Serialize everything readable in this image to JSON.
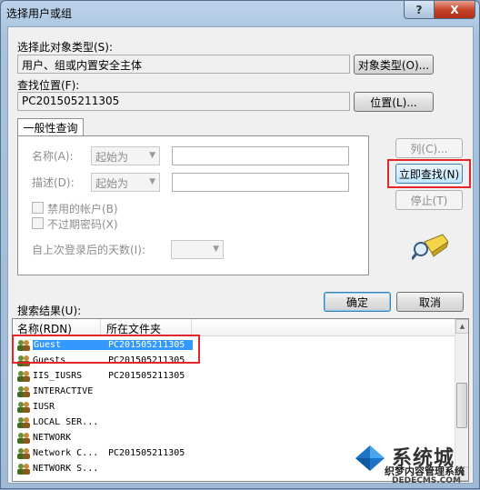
{
  "window": {
    "title": "选择用户或组",
    "help_glyph": "?",
    "close_glyph": "X"
  },
  "object_type": {
    "label": "选择此对象类型(S):",
    "value": "用户、组或内置安全主体",
    "button": "对象类型(O)..."
  },
  "location": {
    "label": "查找位置(F):",
    "value": "PC201505211305",
    "button": "位置(L)..."
  },
  "query": {
    "tab_label": "一般性查询",
    "name_label": "名称(A):",
    "name_mode": "起始为",
    "desc_label": "描述(D):",
    "desc_mode": "起始为",
    "disabled_accounts": "禁用的帐户(B)",
    "no_expire_password": "不过期密码(X)",
    "days_since_login_label": "自上次登录后的天数(I):"
  },
  "buttons": {
    "columns": "列(C)...",
    "find_now": "立即查找(N)",
    "stop": "停止(T)",
    "ok": "确定",
    "cancel": "取消"
  },
  "results": {
    "label": "搜索结果(U):",
    "columns": [
      "名称(RDN)",
      "所在文件夹"
    ],
    "rows": [
      {
        "name": "Guest",
        "folder": "PC201505211305"
      },
      {
        "name": "Guests",
        "folder": "PC201505211305"
      },
      {
        "name": "IIS_IUSRS",
        "folder": "PC201505211305"
      },
      {
        "name": "INTERACTIVE",
        "folder": ""
      },
      {
        "name": "IUSR",
        "folder": ""
      },
      {
        "name": "LOCAL SER...",
        "folder": ""
      },
      {
        "name": "NETWORK",
        "folder": ""
      },
      {
        "name": "Network C...",
        "folder": "PC201505211305"
      },
      {
        "name": "NETWORK S...",
        "folder": ""
      }
    ],
    "selected_index": 0
  },
  "watermark": {
    "title": "系统城",
    "subtitle": "织梦内容管理系统",
    "url": "DEDECMS.COM"
  },
  "colors": {
    "selection": "#3399ff",
    "highlight_box": "#e3262c"
  }
}
